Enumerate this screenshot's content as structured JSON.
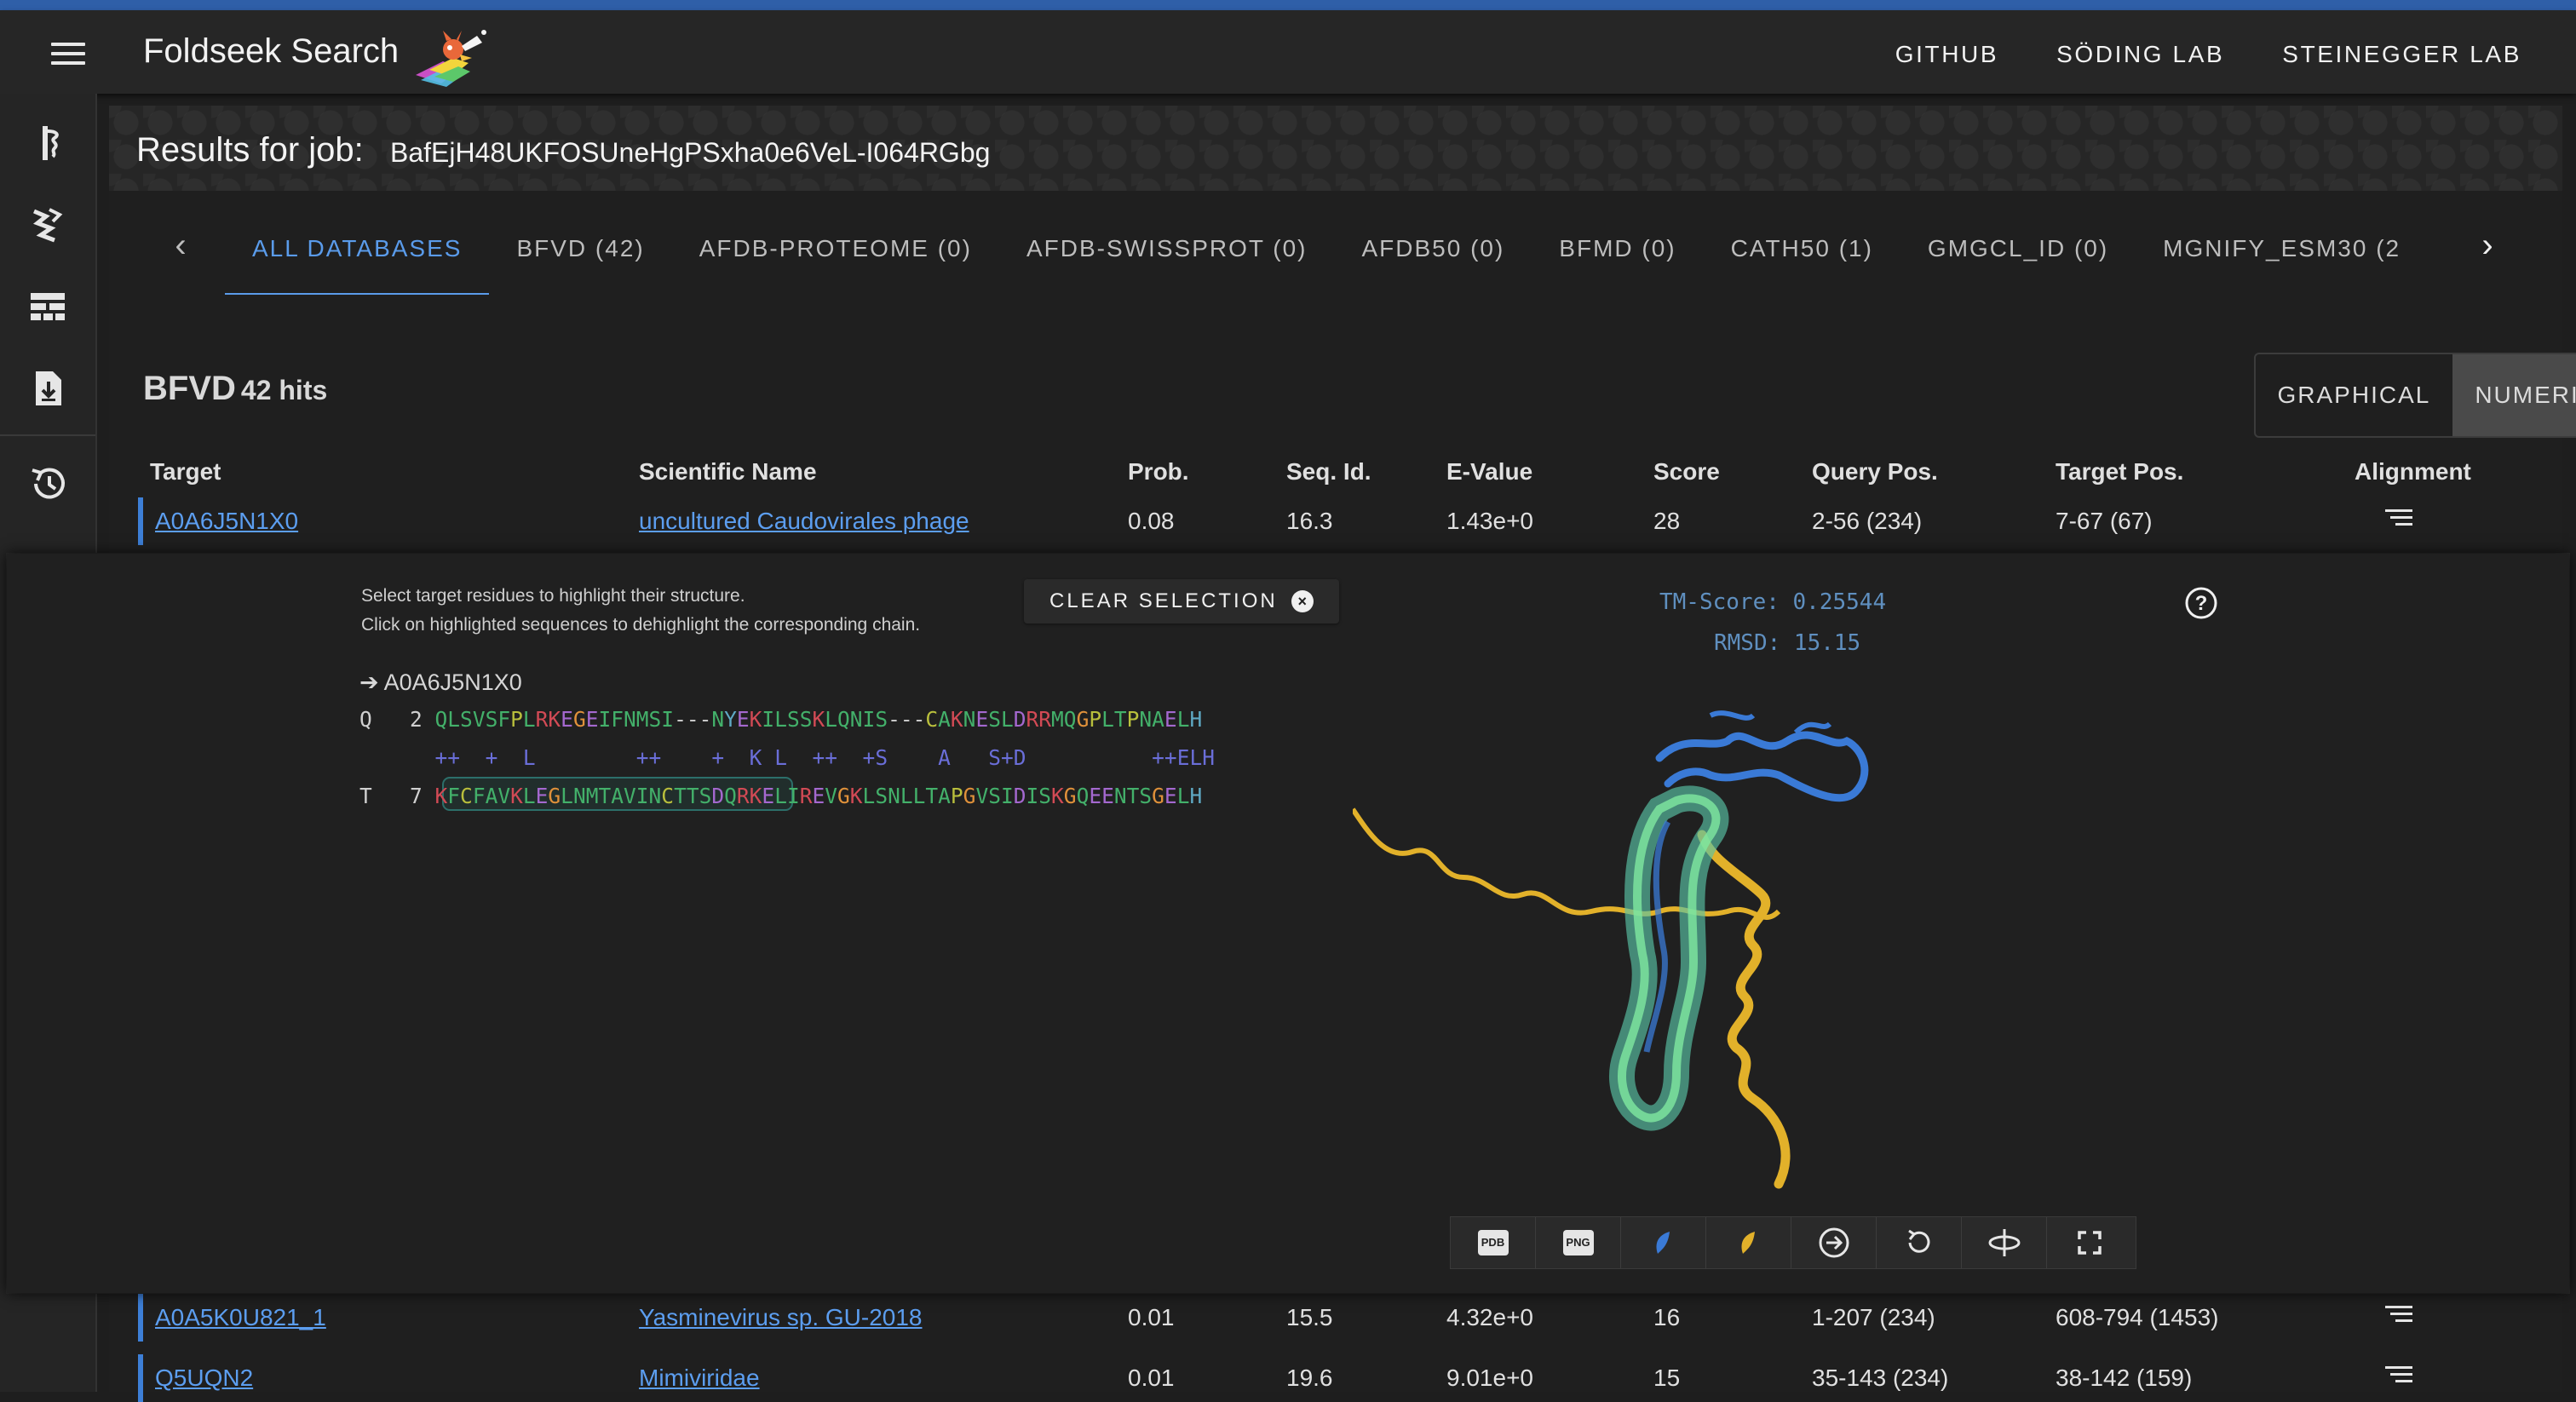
{
  "app": {
    "title": "Foldseek Search"
  },
  "nav": {
    "links": [
      "GITHUB",
      "SÖDING LAB",
      "STEINEGGER LAB"
    ]
  },
  "sidebar": {
    "icons": [
      "search-icon",
      "foldmason-icon",
      "queue-icon",
      "download-icon",
      "history-icon"
    ]
  },
  "results": {
    "label": "Results for job:",
    "job_id": "BafEjH48UKFOSUneHgPSxha0e6VeL-I064RGbg"
  },
  "tabs": [
    "ALL DATABASES",
    "BFVD (42)",
    "AFDB-PROTEOME (0)",
    "AFDB-SWISSPROT (0)",
    "AFDB50 (0)",
    "BFMD (0)",
    "CATH50 (1)",
    "GMGCL_ID (0)",
    "MGNIFY_ESM30 (2"
  ],
  "active_tab": "ALL DATABASES",
  "db": {
    "name": "BFVD",
    "hits": "42 hits",
    "view_graphical": "GRAPHICAL",
    "view_numeric": "NUMERIC",
    "active_view": "NUMERIC"
  },
  "table": {
    "columns": [
      "Target",
      "Scientific Name",
      "Prob.",
      "Seq. Id.",
      "E-Value",
      "Score",
      "Query Pos.",
      "Target Pos.",
      "Alignment"
    ],
    "rows": [
      {
        "target": "A0A6J5N1X0",
        "name": "uncultured Caudovirales phage",
        "prob": "0.08",
        "seqid": "16.3",
        "evalue": "1.43e+0",
        "score": "28",
        "qpos": "2-56 (234)",
        "tpos": "7-67 (67)"
      },
      {
        "target": "A0A5K0U821_1",
        "name": "Yasminevirus sp. GU-2018",
        "prob": "0.01",
        "seqid": "15.5",
        "evalue": "4.32e+0",
        "score": "16",
        "qpos": "1-207 (234)",
        "tpos": "608-794 (1453)"
      },
      {
        "target": "Q5UQN2",
        "name": "Mimiviridae",
        "prob": "0.01",
        "seqid": "19.6",
        "evalue": "9.01e+0",
        "score": "15",
        "qpos": "35-143 (234)",
        "tpos": "38-142 (159)"
      }
    ]
  },
  "alignment": {
    "hint_line1": "Select target residues to highlight their structure.",
    "hint_line2": "Click on highlighted sequences to dehighlight the corresponding chain.",
    "clear_button": "CLEAR SELECTION",
    "target_ref": "➔ A0A6J5N1X0",
    "query_prefix": "Q   2 ",
    "match_prefix": "      ",
    "target_prefix": "T   7 ",
    "query_seq": "QLSVSFPLRKEGEIFNMSI---NYEKILSSKLQNIS---CAKNESLDRRMQGPLTPNAELH",
    "match_line": "++  +  L        ++    +  K L  ++  +S    A   S+D          ++ELH",
    "target_seq": "KFCFAVKLEGLNMTAVINCTTSDQRKELIREVGKLSNLLTAPGVSIDISKGQEENTSGELH",
    "tm_score": "TM-Score: 0.25544",
    "rmsd": "RMSD: 15.15"
  },
  "viewer_toolbar": [
    "pdb-download",
    "png-download",
    "query-toggle",
    "target-toggle",
    "arrow-circle",
    "reset-rotation",
    "toggle-spin",
    "fullscreen"
  ],
  "tool_labels": {
    "pdb": "PDB",
    "png": "PNG"
  },
  "colors": {
    "accent": "#5a9bea",
    "link": "#5c9ef0",
    "query_chain": "#3a7ad6",
    "target_chain": "#e2b12a",
    "highlight": "#59c3a6"
  }
}
